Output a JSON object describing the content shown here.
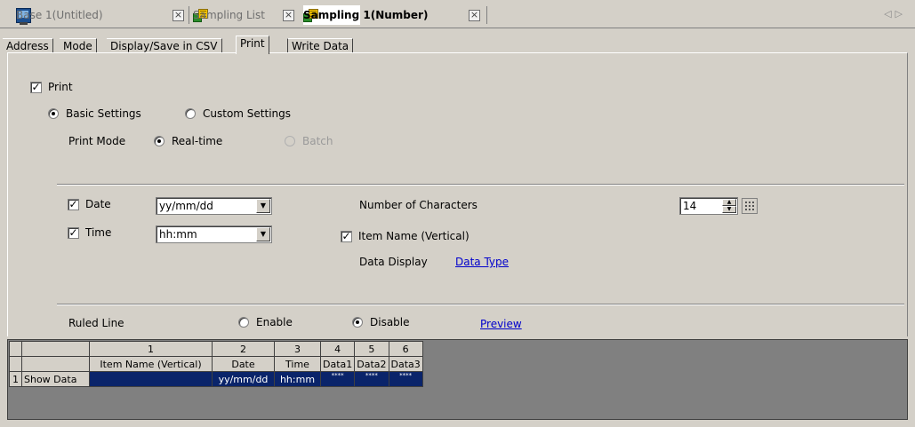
{
  "doc_tabs": [
    {
      "label": "Base 1(Untitled)",
      "icon": "monitor-icon",
      "active": false
    },
    {
      "label": "Sampling List",
      "icon": "sampling-icon",
      "active": false
    },
    {
      "label": "Sampling 1(Number)",
      "icon": "sampling-icon",
      "active": true
    }
  ],
  "sub_tabs": [
    "Address",
    "Mode",
    "Display/Save in CSV",
    "Print",
    "Write Data"
  ],
  "active_sub_tab": "Print",
  "print": {
    "label": "Print",
    "checked": true,
    "basic_settings": "Basic Settings",
    "custom_settings": "Custom Settings",
    "settings_mode": "Basic Settings",
    "print_mode_label": "Print Mode",
    "real_time": "Real-time",
    "batch": "Batch",
    "print_mode": "Real-time"
  },
  "fields": {
    "date_label": "Date",
    "date_checked": true,
    "date_format": "yy/mm/dd",
    "time_label": "Time",
    "time_checked": true,
    "time_format": "hh:mm",
    "num_chars_label": "Number of Characters",
    "num_chars_value": "14",
    "item_name_label": "Item Name (Vertical)",
    "item_name_checked": true,
    "data_display_label": "Data Display",
    "data_type_link": "Data Type"
  },
  "ruled_line": {
    "label": "Ruled Line",
    "enable": "Enable",
    "disable": "Disable",
    "value": "Disable",
    "preview_link": "Preview"
  },
  "preview_table": {
    "col_numbers": [
      "1",
      "2",
      "3",
      "4",
      "5",
      "6"
    ],
    "headers": [
      "Item Name (Vertical)",
      "Date",
      "Time",
      "Data1",
      "Data2",
      "Data3"
    ],
    "row_number": "1",
    "row_label": "Show Data",
    "row_values": [
      "",
      "yy/mm/dd",
      "hh:mm",
      "****",
      "****",
      "****"
    ]
  },
  "colors": {
    "face": "#d4d0c8",
    "selection": "#0a246a",
    "link": "#0000cc",
    "grid_background": "#808080"
  }
}
